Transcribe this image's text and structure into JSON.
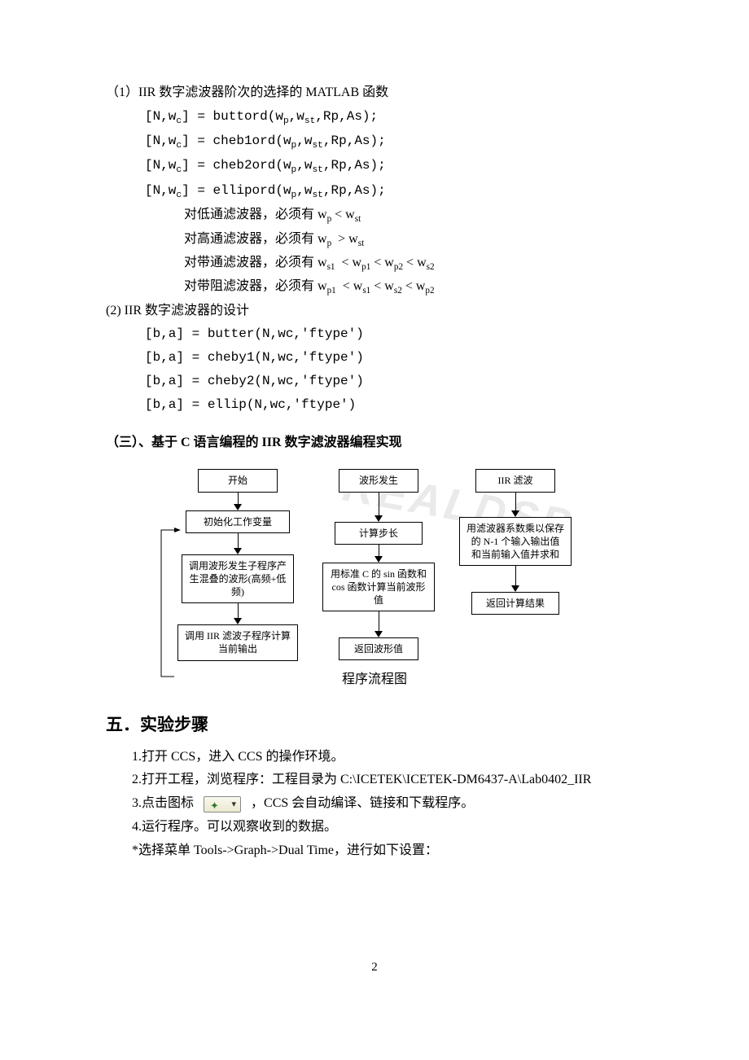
{
  "s1": {
    "title": "（1）IIR 数字滤波器阶次的选择的 MATLAB 函数",
    "lines": [
      {
        "pre": "[N,w",
        "sub1": "c",
        "mid": "] = buttord(w",
        "sub2": "p",
        "mid2": ",w",
        "sub3": "st",
        "tail": ",Rp,As);"
      },
      {
        "pre": "[N,w",
        "sub1": "c",
        "mid": "] = cheb1ord(w",
        "sub2": "p",
        "mid2": ",w",
        "sub3": "st",
        "tail": ",Rp,As);"
      },
      {
        "pre": "[N,w",
        "sub1": "c",
        "mid": "] = cheb2ord(w",
        "sub2": "p",
        "mid2": ",w",
        "sub3": "st",
        "tail": ",Rp,As);"
      },
      {
        "pre": "[N,w",
        "sub1": "c",
        "mid": "] = ellipord(w",
        "sub2": "p",
        "mid2": ",w",
        "sub3": "st",
        "tail": ",Rp,As);"
      }
    ],
    "conds": [
      {
        "t1": "对低通滤波器，必须有 w",
        "s1": "p",
        "t2": " < w",
        "s2": "st",
        "t3": ""
      },
      {
        "t1": "对高通滤波器，必须有 w",
        "s1": "p",
        "t2": "  > w",
        "s2": "st",
        "t3": ""
      },
      {
        "t1": "对带通滤波器，必须有 w",
        "s1": "s1",
        "t2": "  < w",
        "s2": "p1",
        "t3": " < w",
        "s3": "p2",
        "t4": " < w",
        "s4": "s2"
      },
      {
        "t1": "对带阻滤波器，必须有 w",
        "s1": "p1",
        "t2": "  < w",
        "s2": "s1",
        "t3": " < w",
        "s3": "s2",
        "t4": " < w",
        "s4": "p2"
      }
    ]
  },
  "s2": {
    "title": "(2) IIR 数字滤波器的设计",
    "lines": [
      "[b,a] = butter(N,wc,'ftype')",
      "[b,a] = cheby1(N,wc,'ftype')",
      "[b,a] = cheby2(N,wc,'ftype')",
      "[b,a] = ellip(N,wc,'ftype')"
    ]
  },
  "s3": {
    "title": "（三）、基于 C 语言编程的 IIR 数字滤波器编程实现"
  },
  "flow": {
    "col1": [
      "开始",
      "初始化工作变量",
      "调用波形发生子程序产生混叠的波形(高频+低频)",
      "调用 IIR 滤波子程序计算当前输出"
    ],
    "col2": [
      "波形发生",
      "计算步长",
      "用标准 C 的 sin 函数和 cos 函数计算当前波形值",
      "返回波形值"
    ],
    "col3": [
      "IIR 滤波",
      "用滤波器系数乘以保存的 N-1 个输入输出值和当前输入值并求和",
      "返回计算结果"
    ],
    "caption": "程序流程图"
  },
  "s5": {
    "title": "五．实验步骤",
    "steps": [
      "1.打开 CCS，进入 CCS 的操作环境。",
      "2.打开工程，浏览程序：工程目录为 C:\\ICETEK\\ICETEK-DM6437-A\\Lab0402_IIR",
      "",
      "3.点击图标  {icon}  ，CCS 会自动编译、链接和下载程序。",
      "4.运行程序。可以观察收到的数据。",
      "*选择菜单 Tools->Graph->Dual Time，进行如下设置："
    ]
  },
  "watermark": "REALDSP",
  "pagenum": "2"
}
